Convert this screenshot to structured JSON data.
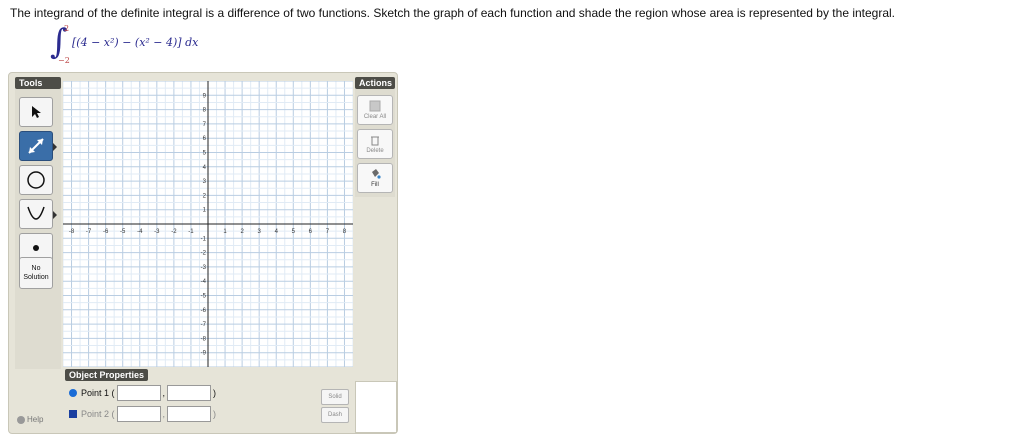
{
  "question": "The integrand of the definite integral is a difference of two functions. Sketch the graph of each function and shade the region whose area is represented by the integral.",
  "integral": {
    "upper": "2",
    "lower": "−2",
    "expression": "[(4 − x²) − (x² − 4)] dx"
  },
  "tools": {
    "title": "Tools",
    "items": [
      "pointer-icon",
      "line-icon",
      "circle-icon",
      "parabola-icon",
      "point-icon"
    ],
    "no_solution": "No Solution"
  },
  "graph": {
    "x_ticks": [
      "-8",
      "-7",
      "-6",
      "-5",
      "-4",
      "-3",
      "-2",
      "-1",
      "1",
      "2",
      "3",
      "4",
      "5",
      "6",
      "7",
      "8"
    ],
    "y_ticks": [
      "9",
      "8",
      "7",
      "6",
      "5",
      "4",
      "3",
      "2",
      "1",
      "-1",
      "-2",
      "-3",
      "-4",
      "-5",
      "-6",
      "-7",
      "-8",
      "-9"
    ],
    "xlim": [
      -8.5,
      8.5
    ],
    "ylim": [
      -10,
      10
    ]
  },
  "actions": {
    "title": "Actions",
    "clear_all": "Clear All",
    "delete": "Delete",
    "fill": "Fill"
  },
  "object_properties": {
    "title": "Object Properties",
    "point1": "Point 1 (",
    "point2": "Point 2 (",
    "sep": ",",
    "close": ")",
    "solid": "Solid",
    "dash": "Dash"
  },
  "help": "Help"
}
